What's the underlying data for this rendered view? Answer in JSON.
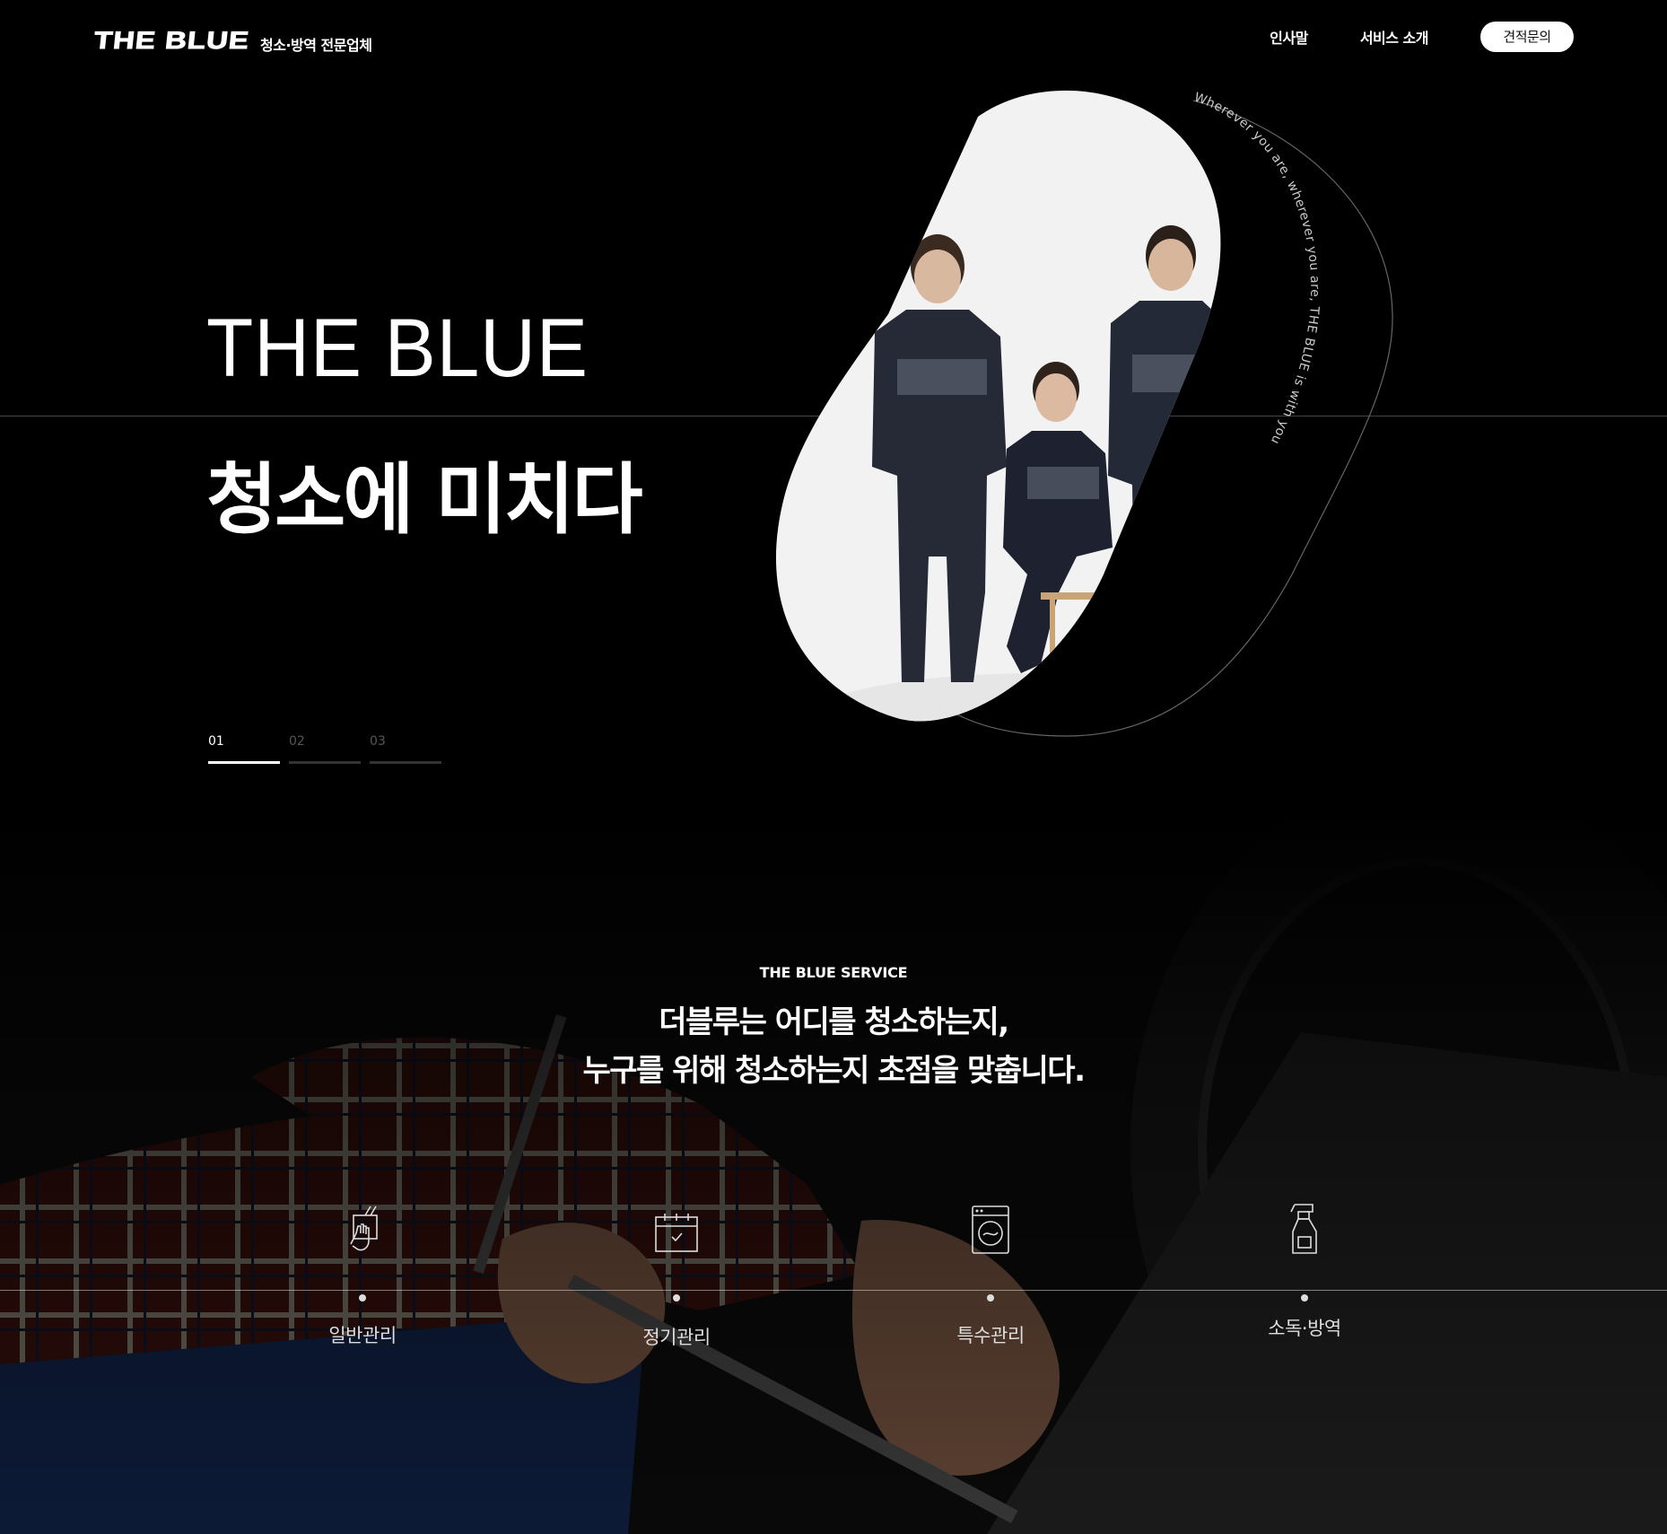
{
  "header": {
    "logo_mark": "THE BLUE",
    "logo_sub": "청소·방역 전문업체",
    "nav": [
      "인사말",
      "서비스 소개"
    ],
    "cta": "견적문의"
  },
  "hero": {
    "title": "THE BLUE",
    "subtitle": "청소에 미치다",
    "curved_text": "Wherever you are, wherever you are, THE BLUE is with you",
    "pager": [
      "01",
      "02",
      "03"
    ],
    "active_slide": 1
  },
  "service": {
    "eyebrow": "THE BLUE SERVICE",
    "heading_line1": "더블루는 어디를 청소하는지,",
    "heading_line2": "누구를 위해 청소하는지 초점을 맞춥니다.",
    "items": [
      {
        "label": "일반관리",
        "icon": "hand-cleaning-icon"
      },
      {
        "label": "정기관리",
        "icon": "calendar-check-icon"
      },
      {
        "label": "특수관리",
        "icon": "washing-machine-icon"
      },
      {
        "label": "소독·방역",
        "icon": "spray-bottle-icon"
      }
    ]
  },
  "colors": {
    "background": "#000000",
    "text": "#ffffff",
    "cta_bg": "#ffffff"
  }
}
